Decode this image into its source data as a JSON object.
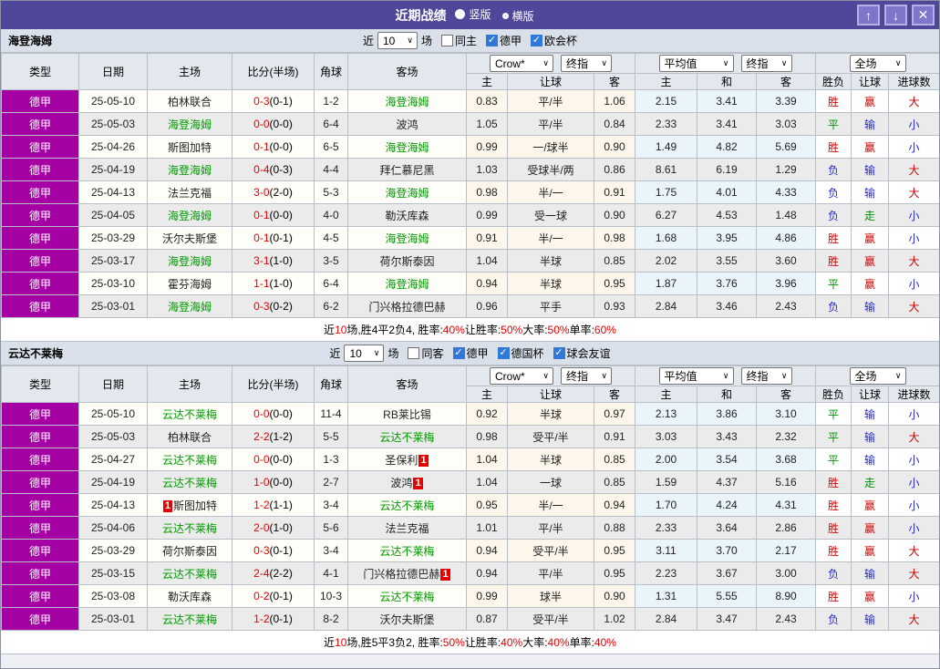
{
  "titlebar": {
    "title": "近期战绩",
    "layout_radios": [
      {
        "label": "竖版",
        "selected": true
      },
      {
        "label": "横版",
        "selected": false
      }
    ],
    "window_buttons": [
      {
        "name": "move-up",
        "icon": "up-arrow-icon",
        "glyph": "↑"
      },
      {
        "name": "move-down",
        "icon": "down-arrow-icon",
        "glyph": "↓"
      },
      {
        "name": "close",
        "icon": "close-icon",
        "glyph": "✕"
      }
    ]
  },
  "colors": {
    "titlebar_purple": "#4f4799",
    "type_cell_magenta": "#a400a4",
    "subject_team_green": "#009900",
    "score_red": "#e60000",
    "win_red": "#d10000",
    "draw_green": "#008f00",
    "lose_blue": "#2626cc",
    "checkbox_blue": "#3179d8"
  },
  "table_header": {
    "left_cols": [
      "类型",
      "日期",
      "主场",
      "比分(半场)",
      "角球",
      "客场"
    ],
    "groups": [
      {
        "dropdowns": [
          "Crow*",
          "终指"
        ]
      },
      {
        "dropdowns": [
          "平均值",
          "终指"
        ]
      },
      {
        "dropdowns": [
          "全场"
        ]
      }
    ],
    "sub_cols": [
      "主",
      "让球",
      "客",
      "主",
      "和",
      "客",
      "胜负",
      "让球",
      "进球数"
    ]
  },
  "sections": [
    {
      "team": "海登海姆",
      "filter": {
        "near_label": "近",
        "count": "10",
        "games_label": "场",
        "checkboxes": [
          {
            "label": "同主",
            "checked": false
          },
          {
            "label": "德甲",
            "checked": true
          },
          {
            "label": "欧会杯",
            "checked": true
          }
        ]
      },
      "rows": [
        {
          "league": "德甲",
          "date": "25-05-10",
          "home": {
            "name": "柏林联合"
          },
          "score": "0-3",
          "half": "(0-1)",
          "corners": "1-2",
          "away": {
            "name": "海登海姆",
            "subject": true
          },
          "odds": [
            "0.83",
            "平/半",
            "1.06"
          ],
          "avg": [
            "2.15",
            "3.41",
            "3.39"
          ],
          "results": [
            [
              "胜",
              "r"
            ],
            [
              "赢",
              "r"
            ],
            [
              "大",
              "r"
            ]
          ]
        },
        {
          "league": "德甲",
          "date": "25-05-03",
          "home": {
            "name": "海登海姆",
            "subject": true
          },
          "score": "0-0",
          "half": "(0-0)",
          "corners": "6-4",
          "away": {
            "name": "波鸿"
          },
          "odds": [
            "1.05",
            "平/半",
            "0.84"
          ],
          "avg": [
            "2.33",
            "3.41",
            "3.03"
          ],
          "results": [
            [
              "平",
              "g"
            ],
            [
              "输",
              "b"
            ],
            [
              "小",
              "b"
            ]
          ]
        },
        {
          "league": "德甲",
          "date": "25-04-26",
          "home": {
            "name": "斯图加特"
          },
          "score": "0-1",
          "half": "(0-0)",
          "corners": "6-5",
          "away": {
            "name": "海登海姆",
            "subject": true
          },
          "odds": [
            "0.99",
            "一/球半",
            "0.90"
          ],
          "avg": [
            "1.49",
            "4.82",
            "5.69"
          ],
          "results": [
            [
              "胜",
              "r"
            ],
            [
              "赢",
              "r"
            ],
            [
              "小",
              "b"
            ]
          ]
        },
        {
          "league": "德甲",
          "date": "25-04-19",
          "home": {
            "name": "海登海姆",
            "subject": true
          },
          "score": "0-4",
          "half": "(0-3)",
          "corners": "4-4",
          "away": {
            "name": "拜仁慕尼黑"
          },
          "odds": [
            "1.03",
            "受球半/两",
            "0.86"
          ],
          "avg": [
            "8.61",
            "6.19",
            "1.29"
          ],
          "results": [
            [
              "负",
              "b"
            ],
            [
              "输",
              "b"
            ],
            [
              "大",
              "r"
            ]
          ]
        },
        {
          "league": "德甲",
          "date": "25-04-13",
          "home": {
            "name": "法兰克福"
          },
          "score": "3-0",
          "half": "(2-0)",
          "corners": "5-3",
          "away": {
            "name": "海登海姆",
            "subject": true
          },
          "odds": [
            "0.98",
            "半/一",
            "0.91"
          ],
          "avg": [
            "1.75",
            "4.01",
            "4.33"
          ],
          "results": [
            [
              "负",
              "b"
            ],
            [
              "输",
              "b"
            ],
            [
              "大",
              "r"
            ]
          ]
        },
        {
          "league": "德甲",
          "date": "25-04-05",
          "home": {
            "name": "海登海姆",
            "subject": true
          },
          "score": "0-1",
          "half": "(0-0)",
          "corners": "4-0",
          "away": {
            "name": "勒沃库森"
          },
          "odds": [
            "0.99",
            "受一球",
            "0.90"
          ],
          "avg": [
            "6.27",
            "4.53",
            "1.48"
          ],
          "results": [
            [
              "负",
              "b"
            ],
            [
              "走",
              "g"
            ],
            [
              "小",
              "b"
            ]
          ]
        },
        {
          "league": "德甲",
          "date": "25-03-29",
          "home": {
            "name": "沃尔夫斯堡"
          },
          "score": "0-1",
          "half": "(0-1)",
          "corners": "4-5",
          "away": {
            "name": "海登海姆",
            "subject": true
          },
          "odds": [
            "0.91",
            "半/一",
            "0.98"
          ],
          "avg": [
            "1.68",
            "3.95",
            "4.86"
          ],
          "results": [
            [
              "胜",
              "r"
            ],
            [
              "赢",
              "r"
            ],
            [
              "小",
              "b"
            ]
          ]
        },
        {
          "league": "德甲",
          "date": "25-03-17",
          "home": {
            "name": "海登海姆",
            "subject": true
          },
          "score": "3-1",
          "half": "(1-0)",
          "corners": "3-5",
          "away": {
            "name": "荷尔斯泰因"
          },
          "odds": [
            "1.04",
            "半球",
            "0.85"
          ],
          "avg": [
            "2.02",
            "3.55",
            "3.60"
          ],
          "results": [
            [
              "胜",
              "r"
            ],
            [
              "赢",
              "r"
            ],
            [
              "大",
              "r"
            ]
          ]
        },
        {
          "league": "德甲",
          "date": "25-03-10",
          "home": {
            "name": "霍芬海姆"
          },
          "score": "1-1",
          "half": "(1-0)",
          "corners": "6-4",
          "away": {
            "name": "海登海姆",
            "subject": true
          },
          "odds": [
            "0.94",
            "半球",
            "0.95"
          ],
          "avg": [
            "1.87",
            "3.76",
            "3.96"
          ],
          "results": [
            [
              "平",
              "g"
            ],
            [
              "赢",
              "r"
            ],
            [
              "小",
              "b"
            ]
          ]
        },
        {
          "league": "德甲",
          "date": "25-03-01",
          "home": {
            "name": "海登海姆",
            "subject": true
          },
          "score": "0-3",
          "half": "(0-2)",
          "corners": "6-2",
          "away": {
            "name": "门兴格拉德巴赫"
          },
          "odds": [
            "0.96",
            "平手",
            "0.93"
          ],
          "avg": [
            "2.84",
            "3.46",
            "2.43"
          ],
          "results": [
            [
              "负",
              "b"
            ],
            [
              "输",
              "b"
            ],
            [
              "大",
              "r"
            ]
          ]
        }
      ],
      "summary": [
        [
          "近",
          0
        ],
        [
          "10",
          1
        ],
        [
          "场,胜4平2负4, 胜率:",
          0
        ],
        [
          "40%",
          1
        ],
        [
          " 让胜率:",
          0
        ],
        [
          "50%",
          1
        ],
        [
          " 大率:",
          0
        ],
        [
          "50%",
          1
        ],
        [
          " 单率:",
          0
        ],
        [
          "60%",
          1
        ]
      ]
    },
    {
      "team": "云达不莱梅",
      "filter": {
        "near_label": "近",
        "count": "10",
        "games_label": "场",
        "checkboxes": [
          {
            "label": "同客",
            "checked": false
          },
          {
            "label": "德甲",
            "checked": true
          },
          {
            "label": "德国杯",
            "checked": true
          },
          {
            "label": "球会友谊",
            "checked": true
          }
        ]
      },
      "rows": [
        {
          "league": "德甲",
          "date": "25-05-10",
          "home": {
            "name": "云达不莱梅",
            "subject": true
          },
          "score": "0-0",
          "half": "(0-0)",
          "corners": "11-4",
          "away": {
            "name": "RB莱比锡"
          },
          "odds": [
            "0.92",
            "半球",
            "0.97"
          ],
          "avg": [
            "2.13",
            "3.86",
            "3.10"
          ],
          "results": [
            [
              "平",
              "g"
            ],
            [
              "输",
              "b"
            ],
            [
              "小",
              "b"
            ]
          ]
        },
        {
          "league": "德甲",
          "date": "25-05-03",
          "home": {
            "name": "柏林联合"
          },
          "score": "2-2",
          "half": "(1-2)",
          "corners": "5-5",
          "away": {
            "name": "云达不莱梅",
            "subject": true
          },
          "odds": [
            "0.98",
            "受平/半",
            "0.91"
          ],
          "avg": [
            "3.03",
            "3.43",
            "2.32"
          ],
          "results": [
            [
              "平",
              "g"
            ],
            [
              "输",
              "b"
            ],
            [
              "大",
              "r"
            ]
          ]
        },
        {
          "league": "德甲",
          "date": "25-04-27",
          "home": {
            "name": "云达不莱梅",
            "subject": true
          },
          "score": "0-0",
          "half": "(0-0)",
          "corners": "1-3",
          "away": {
            "name": "圣保利",
            "card": "1",
            "card_pos": "right"
          },
          "odds": [
            "1.04",
            "半球",
            "0.85"
          ],
          "avg": [
            "2.00",
            "3.54",
            "3.68"
          ],
          "results": [
            [
              "平",
              "g"
            ],
            [
              "输",
              "b"
            ],
            [
              "小",
              "b"
            ]
          ]
        },
        {
          "league": "德甲",
          "date": "25-04-19",
          "home": {
            "name": "云达不莱梅",
            "subject": true
          },
          "score": "1-0",
          "half": "(0-0)",
          "corners": "2-7",
          "away": {
            "name": "波鸿",
            "card": "1",
            "card_pos": "right"
          },
          "odds": [
            "1.04",
            "一球",
            "0.85"
          ],
          "avg": [
            "1.59",
            "4.37",
            "5.16"
          ],
          "results": [
            [
              "胜",
              "r"
            ],
            [
              "走",
              "g"
            ],
            [
              "小",
              "b"
            ]
          ]
        },
        {
          "league": "德甲",
          "date": "25-04-13",
          "home": {
            "name": "斯图加特",
            "card": "1",
            "card_pos": "left"
          },
          "score": "1-2",
          "half": "(1-1)",
          "corners": "3-4",
          "away": {
            "name": "云达不莱梅",
            "subject": true
          },
          "odds": [
            "0.95",
            "半/一",
            "0.94"
          ],
          "avg": [
            "1.70",
            "4.24",
            "4.31"
          ],
          "results": [
            [
              "胜",
              "r"
            ],
            [
              "赢",
              "r"
            ],
            [
              "小",
              "b"
            ]
          ]
        },
        {
          "league": "德甲",
          "date": "25-04-06",
          "home": {
            "name": "云达不莱梅",
            "subject": true
          },
          "score": "2-0",
          "half": "(1-0)",
          "corners": "5-6",
          "away": {
            "name": "法兰克福"
          },
          "odds": [
            "1.01",
            "平/半",
            "0.88"
          ],
          "avg": [
            "2.33",
            "3.64",
            "2.86"
          ],
          "results": [
            [
              "胜",
              "r"
            ],
            [
              "赢",
              "r"
            ],
            [
              "小",
              "b"
            ]
          ]
        },
        {
          "league": "德甲",
          "date": "25-03-29",
          "home": {
            "name": "荷尔斯泰因"
          },
          "score": "0-3",
          "half": "(0-1)",
          "corners": "3-4",
          "away": {
            "name": "云达不莱梅",
            "subject": true
          },
          "odds": [
            "0.94",
            "受平/半",
            "0.95"
          ],
          "avg": [
            "3.11",
            "3.70",
            "2.17"
          ],
          "results": [
            [
              "胜",
              "r"
            ],
            [
              "赢",
              "r"
            ],
            [
              "大",
              "r"
            ]
          ]
        },
        {
          "league": "德甲",
          "date": "25-03-15",
          "home": {
            "name": "云达不莱梅",
            "subject": true
          },
          "score": "2-4",
          "half": "(2-2)",
          "corners": "4-1",
          "away": {
            "name": "门兴格拉德巴赫",
            "card": "1",
            "card_pos": "right"
          },
          "odds": [
            "0.94",
            "平/半",
            "0.95"
          ],
          "avg": [
            "2.23",
            "3.67",
            "3.00"
          ],
          "results": [
            [
              "负",
              "b"
            ],
            [
              "输",
              "b"
            ],
            [
              "大",
              "r"
            ]
          ]
        },
        {
          "league": "德甲",
          "date": "25-03-08",
          "home": {
            "name": "勒沃库森"
          },
          "score": "0-2",
          "half": "(0-1)",
          "corners": "10-3",
          "away": {
            "name": "云达不莱梅",
            "subject": true
          },
          "odds": [
            "0.99",
            "球半",
            "0.90"
          ],
          "avg": [
            "1.31",
            "5.55",
            "8.90"
          ],
          "results": [
            [
              "胜",
              "r"
            ],
            [
              "赢",
              "r"
            ],
            [
              "小",
              "b"
            ]
          ]
        },
        {
          "league": "德甲",
          "date": "25-03-01",
          "home": {
            "name": "云达不莱梅",
            "subject": true
          },
          "score": "1-2",
          "half": "(0-1)",
          "corners": "8-2",
          "away": {
            "name": "沃尔夫斯堡"
          },
          "odds": [
            "0.87",
            "受平/半",
            "1.02"
          ],
          "avg": [
            "2.84",
            "3.47",
            "2.43"
          ],
          "results": [
            [
              "负",
              "b"
            ],
            [
              "输",
              "b"
            ],
            [
              "大",
              "r"
            ]
          ]
        }
      ],
      "summary": [
        [
          "近",
          0
        ],
        [
          "10",
          1
        ],
        [
          "场,胜5平3负2, 胜率:",
          0
        ],
        [
          "50%",
          1
        ],
        [
          " 让胜率:",
          0
        ],
        [
          "40%",
          1
        ],
        [
          " 大率:",
          0
        ],
        [
          "40%",
          1
        ],
        [
          " 单率:",
          0
        ],
        [
          "40%",
          1
        ]
      ]
    }
  ]
}
